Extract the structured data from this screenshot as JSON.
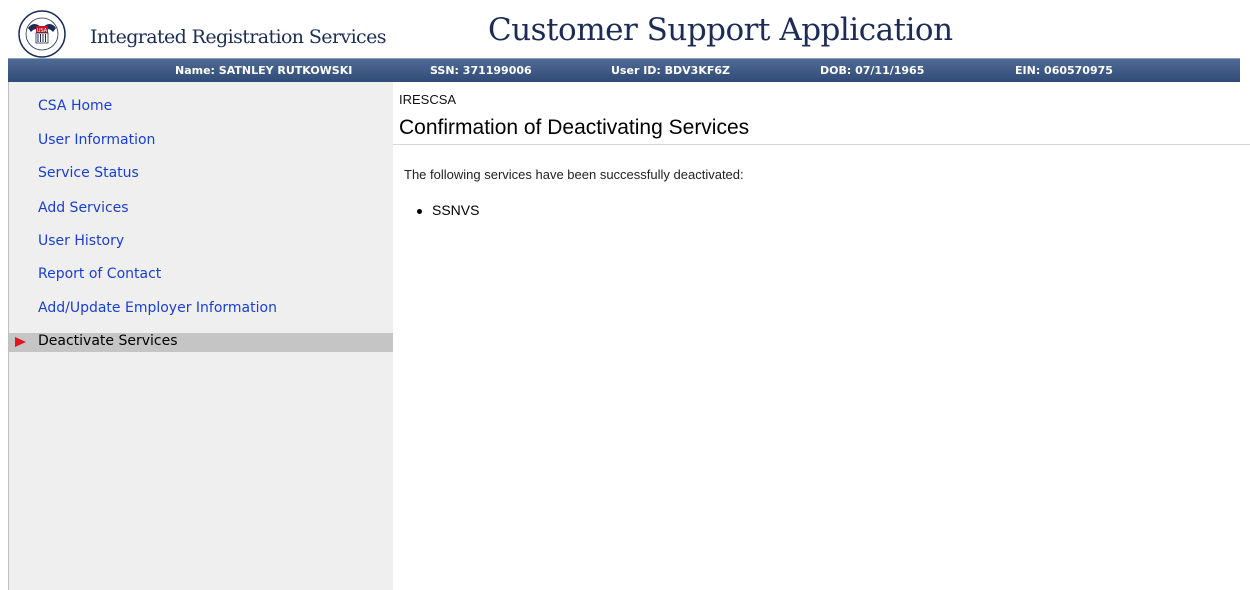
{
  "header": {
    "org_name": "Integrated Registration Services",
    "app_title": "Customer Support Application",
    "logo_icon": "ssa-seal-icon"
  },
  "infobar": {
    "name": "Name: SATNLEY RUTKOWSKI",
    "ssn": "SSN: 371199006",
    "user_id": "User ID: BDV3KF6Z",
    "dob": "DOB: 07/11/1965",
    "ein": "EIN: 060570975"
  },
  "sidebar": {
    "items": [
      {
        "label": "CSA Home"
      },
      {
        "label": "User Information"
      },
      {
        "label": "Service Status"
      },
      {
        "label": "Add Services"
      },
      {
        "label": "User History"
      },
      {
        "label": "Report of Contact"
      },
      {
        "label": "Add/Update Employer Information"
      },
      {
        "label": "Deactivate Services",
        "active": true,
        "icon": "red-arrow-icon"
      }
    ]
  },
  "main": {
    "page_id": "IRESCSA",
    "title": "Confirmation of Deactivating Services",
    "message": "The following services have been successfully deactivated:",
    "services": [
      "SSNVS"
    ]
  },
  "colors": {
    "infobar": "#3a5580",
    "link": "#1a3fcf",
    "active_bg": "#c5c5c5",
    "arrow": "#e2141e",
    "title": "#1d2c55"
  }
}
